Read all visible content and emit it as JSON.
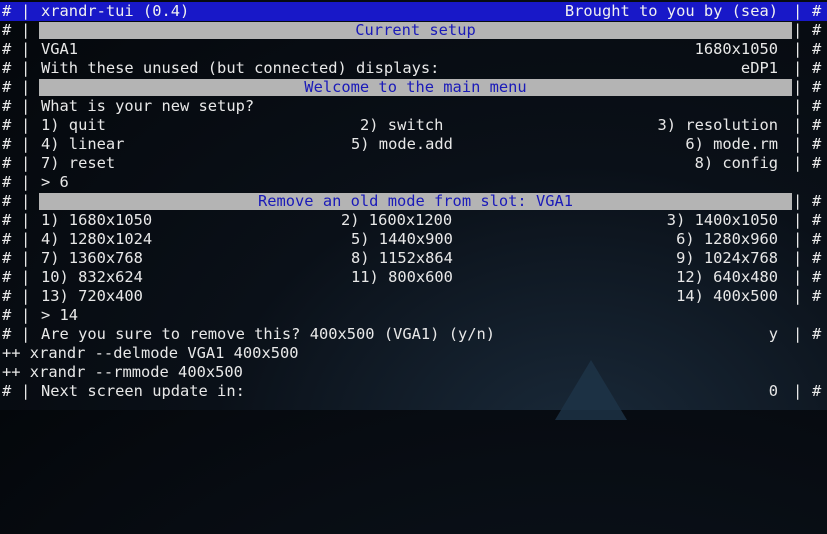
{
  "edge": {
    "hash": "#",
    "pipe": "|"
  },
  "title": {
    "left": "xrandr-tui (0.4)",
    "right": "Brought to you by (sea)"
  },
  "current": {
    "banner": "Current setup",
    "display": "VGA1",
    "resolution": "1680x1050",
    "unused_text": "With these unused (but connected) displays:",
    "unused_value": "eDP1"
  },
  "menu": {
    "banner": "Welcome to the main menu",
    "question": "What is your new setup?",
    "options": [
      [
        "1) quit",
        "2) switch",
        "3) resolution"
      ],
      [
        "4) linear",
        "5) mode.add",
        "6) mode.rm"
      ],
      [
        "7) reset",
        "",
        "8) config"
      ]
    ],
    "prompt": "> 6"
  },
  "remove": {
    "banner": "Remove an old mode from slot: VGA1",
    "modes": [
      [
        "1) 1680x1050",
        "2) 1600x1200",
        "3) 1400x1050"
      ],
      [
        "4) 1280x1024",
        "5) 1440x900",
        "6) 1280x960"
      ],
      [
        "7) 1360x768",
        "8) 1152x864",
        "9) 1024x768"
      ],
      [
        "10) 832x624",
        "11) 800x600",
        "12) 640x480"
      ],
      [
        "13) 720x400",
        "",
        "14) 400x500"
      ]
    ],
    "prompt": "> 14",
    "confirm_text": "Are you sure to remove this? 400x500 (VGA1) (y/n)",
    "confirm_answer": "y"
  },
  "commands": [
    "++ xrandr --delmode VGA1 400x500",
    "++ xrandr --rmmode 400x500"
  ],
  "footer": {
    "text": "Next screen update in:",
    "countdown": "0"
  }
}
